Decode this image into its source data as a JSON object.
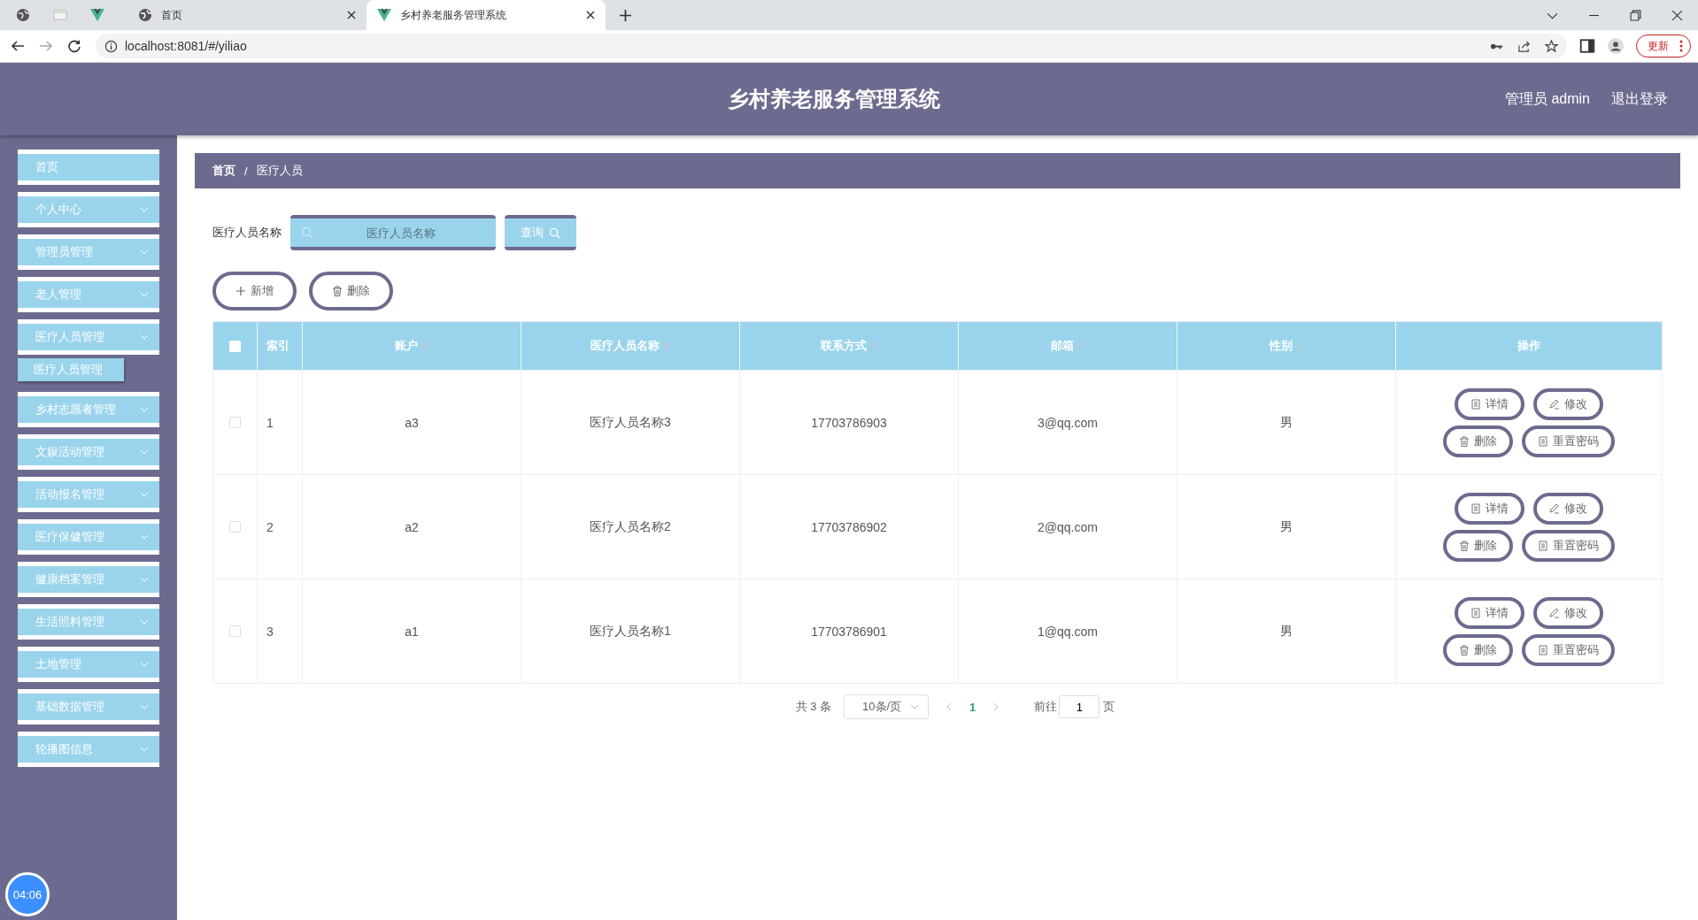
{
  "browser": {
    "tabs": [
      {
        "title": "首页",
        "selected": false
      },
      {
        "title": "乡村养老服务管理系统",
        "selected": true
      }
    ],
    "address": "localhost:8081/#/yiliao",
    "update_button": "更新"
  },
  "header": {
    "title": "乡村养老服务管理系统",
    "user": "管理员 admin",
    "logout": "退出登录"
  },
  "sidebar": {
    "items": [
      {
        "label": "首页",
        "expandable": false
      },
      {
        "label": "个人中心",
        "expandable": true
      },
      {
        "label": "管理员管理",
        "expandable": true
      },
      {
        "label": "老人管理",
        "expandable": true
      },
      {
        "label": "医疗人员管理",
        "expandable": true,
        "children": [
          {
            "label": "医疗人员管理"
          }
        ]
      },
      {
        "label": "乡村志愿者管理",
        "expandable": true
      },
      {
        "label": "文娱活动管理",
        "expandable": true
      },
      {
        "label": "活动报名管理",
        "expandable": true
      },
      {
        "label": "医疗保健管理",
        "expandable": true
      },
      {
        "label": "健康档案管理",
        "expandable": true
      },
      {
        "label": "生活照料管理",
        "expandable": true
      },
      {
        "label": "土地管理",
        "expandable": true
      },
      {
        "label": "基础数据管理",
        "expandable": true
      },
      {
        "label": "轮播图信息",
        "expandable": true
      }
    ],
    "timer": "04:06"
  },
  "breadcrumb": {
    "items": [
      "首页",
      "医疗人员"
    ],
    "separator": "/"
  },
  "search": {
    "label": "医疗人员名称",
    "placeholder": "医疗人员名称",
    "button": "查询"
  },
  "toolbar": [
    {
      "label": "新增",
      "kind": "add"
    },
    {
      "label": "删除",
      "kind": "delete"
    }
  ],
  "table": {
    "header_checked": false,
    "columns": [
      {
        "label": "索引",
        "sortable": false
      },
      {
        "label": "账户",
        "sortable": true
      },
      {
        "label": "医疗人员名称",
        "sortable": true
      },
      {
        "label": "联系方式",
        "sortable": true
      },
      {
        "label": "邮箱",
        "sortable": true
      },
      {
        "label": "性别",
        "sortable": true
      },
      {
        "label": "操作",
        "sortable": false
      }
    ],
    "rows": [
      {
        "checked": false,
        "cells": [
          "1",
          "a3",
          "医疗人员名称3",
          "17703786903",
          "3@qq.com",
          "男"
        ],
        "actions": [
          {
            "label": "详情",
            "kind": "doc"
          },
          {
            "label": "修改",
            "kind": "edit"
          },
          {
            "label": "删除",
            "kind": "delete"
          },
          {
            "label": "重置密码",
            "kind": "doc"
          }
        ]
      },
      {
        "checked": false,
        "cells": [
          "2",
          "a2",
          "医疗人员名称2",
          "17703786902",
          "2@qq.com",
          "男"
        ],
        "actions": [
          {
            "label": "详情",
            "kind": "doc"
          },
          {
            "label": "修改",
            "kind": "edit"
          },
          {
            "label": "删除",
            "kind": "delete"
          },
          {
            "label": "重置密码",
            "kind": "doc"
          }
        ]
      },
      {
        "checked": false,
        "cells": [
          "3",
          "a1",
          "医疗人员名称1",
          "17703786901",
          "1@qq.com",
          "男"
        ],
        "actions": [
          {
            "label": "详情",
            "kind": "doc"
          },
          {
            "label": "修改",
            "kind": "edit"
          },
          {
            "label": "删除",
            "kind": "delete"
          },
          {
            "label": "重置密码",
            "kind": "doc"
          }
        ]
      }
    ]
  },
  "pagination": {
    "total": "共 3 条",
    "page_size": "10条/页",
    "pages": [
      {
        "label": "1",
        "selected": true
      }
    ],
    "goto_label": "前往",
    "goto_value": "1",
    "goto_suffix": "页"
  }
}
